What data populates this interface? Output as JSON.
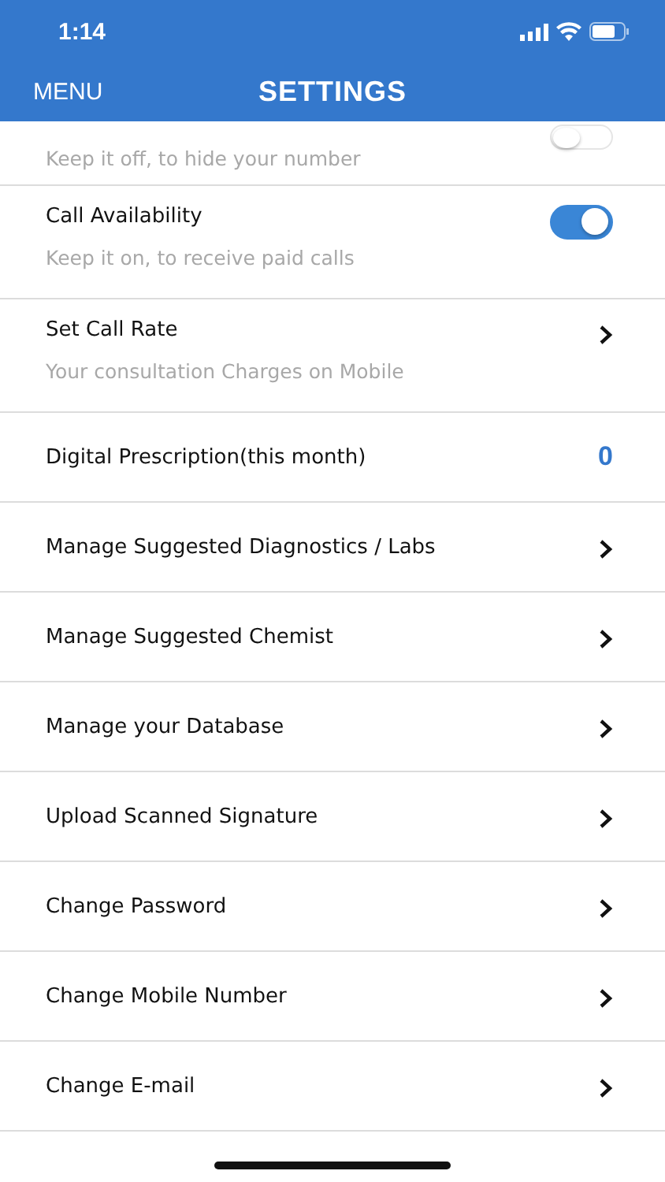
{
  "status_bar": {
    "time": "1:14"
  },
  "header": {
    "menu": "MENU",
    "title": "SETTINGS"
  },
  "items": [
    {
      "kind": "toggle",
      "subtitle": "Keep it off, to hide your number",
      "on": false,
      "partial": true
    },
    {
      "kind": "toggle",
      "title": "Call Availability",
      "subtitle": "Keep it on, to receive paid calls",
      "on": true
    },
    {
      "kind": "link",
      "title": "Set Call Rate",
      "subtitle": "Your consultation Charges on Mobile"
    },
    {
      "kind": "count",
      "title": "Digital Prescription(this month)",
      "value": "0"
    },
    {
      "kind": "link",
      "title": "Manage Suggested Diagnostics / Labs"
    },
    {
      "kind": "link",
      "title": "Manage Suggested Chemist"
    },
    {
      "kind": "link",
      "title": "Manage your Database"
    },
    {
      "kind": "link",
      "title": "Upload Scanned Signature"
    },
    {
      "kind": "link",
      "title": "Change Password"
    },
    {
      "kind": "link",
      "title": "Change Mobile Number"
    },
    {
      "kind": "link",
      "title": "Change E-mail"
    }
  ]
}
